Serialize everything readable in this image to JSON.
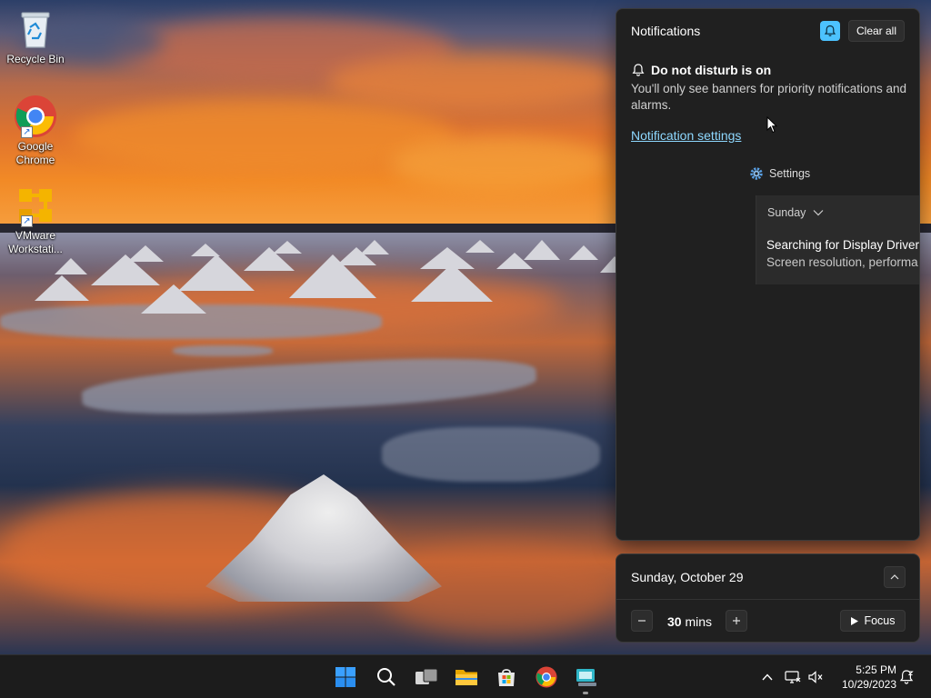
{
  "desktop": {
    "icons": [
      {
        "label": "Recycle Bin",
        "icon": "recycle-bin-icon"
      },
      {
        "label": "Google Chrome",
        "icon": "chrome-icon"
      },
      {
        "label": "VMware Workstati...",
        "icon": "vmware-icon"
      }
    ]
  },
  "notifications": {
    "title": "Notifications",
    "clear_all_label": "Clear all",
    "dnd_heading": "Do not disturb is on",
    "dnd_description": "You'll only see banners for priority notifications and alarms.",
    "settings_link": "Notification settings",
    "group": {
      "app_name": "Settings",
      "day": "Sunday",
      "card_title": "Searching for Display Driver",
      "card_body": "Screen resolution, performa"
    }
  },
  "calendar": {
    "date_label": "Sunday, October 29",
    "focus_minutes": "30",
    "focus_unit": "mins",
    "focus_label": "Focus"
  },
  "taskbar": {
    "apps": [
      "start-icon",
      "search-icon",
      "task-view-icon",
      "file-explorer-icon",
      "microsoft-store-icon",
      "chrome-icon",
      "remote-desktop-icon"
    ],
    "clock_time": "5:25 PM",
    "clock_date": "10/29/2023"
  },
  "colors": {
    "accent": "#4cc2ff",
    "link": "#8ed8ff",
    "panel_bg": "#202020",
    "taskbar_bg": "#1c1c1c"
  }
}
